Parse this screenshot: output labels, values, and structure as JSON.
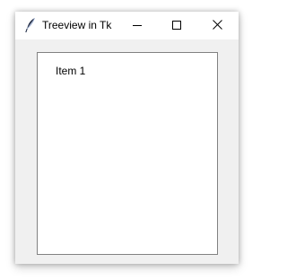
{
  "window": {
    "title": "Treeview in Tk",
    "icon": "tk-feather-icon",
    "controls": {
      "minimize": "minimize-icon",
      "maximize": "maximize-icon",
      "close": "close-icon"
    }
  },
  "treeview": {
    "items": [
      {
        "label": "Item 1"
      }
    ]
  },
  "colors": {
    "window_bg": "#f0f0f0",
    "titlebar_bg": "#ffffff",
    "tree_bg": "#ffffff",
    "tree_border": "#828282"
  }
}
